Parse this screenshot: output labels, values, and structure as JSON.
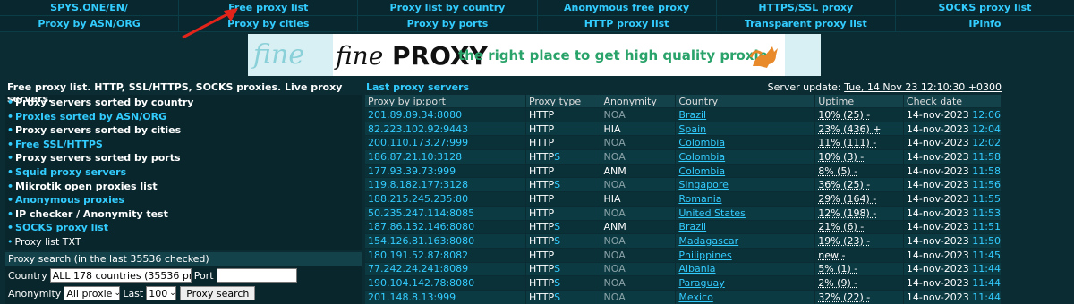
{
  "nav": {
    "row1": [
      "SPYS.ONE/EN/",
      "Free proxy list",
      "Proxy list by country",
      "Anonymous free proxy",
      "HTTPS/SSL proxy",
      "SOCKS proxy list"
    ],
    "row2": [
      "Proxy by ASN/ORG",
      "Proxy by cities",
      "Proxy by ports",
      "HTTP proxy list",
      "Transparent proxy list",
      "IPinfo"
    ]
  },
  "banner": {
    "fine_text": "fine",
    "logo_italic": "fine",
    "logo_bold": "PROXY",
    "tagline": "the right place to get high quality proxies"
  },
  "left": {
    "title": "Free proxy list. HTTP, SSL/HTTPS, SOCKS proxies. Live proxy servers.",
    "menu": [
      {
        "label": "Proxy servers sorted by country",
        "style": "white"
      },
      {
        "label": "Proxies sorted by ASN/ORG",
        "style": "cyan"
      },
      {
        "label": "Proxy servers sorted by cities",
        "style": "white"
      },
      {
        "label": "Free SSL/HTTPS",
        "style": "cyan"
      },
      {
        "label": "Proxy servers sorted by ports",
        "style": "white"
      },
      {
        "label": "Squid proxy servers",
        "style": "cyan"
      },
      {
        "label": "Mikrotik open proxies list",
        "style": "white"
      },
      {
        "label": "Anonymous proxies",
        "style": "cyan"
      },
      {
        "label": "IP checker / Anonymity test",
        "style": "white"
      },
      {
        "label": "SOCKS proxy list",
        "style": "cyan"
      },
      {
        "label": "Proxy list TXT",
        "style": "plain"
      }
    ]
  },
  "search": {
    "title": "Proxy search (in the last 35536 checked)",
    "country_label": "Country",
    "country_value": "ALL 178 countries (35536 pr",
    "port_label": "Port",
    "anonymity_label": "Anonymity",
    "anonymity_value": "All proxie",
    "last_label": "Last",
    "last_value": "100",
    "button": "Proxy search"
  },
  "table": {
    "title": "Last proxy servers",
    "update_label": "Server update:",
    "update_value": "Tue, 14 Nov 23 12:10:30 +0300",
    "headers": [
      "Proxy by ip:port",
      "Proxy type",
      "Anonymity",
      "Country",
      "Uptime",
      "Check date"
    ],
    "rows": [
      {
        "ip": "201.89.89.34:8080",
        "type": "HTTP",
        "anon": "NOA",
        "country": "Brazil",
        "uptime": "10% (25) -",
        "date": "14-nov-2023",
        "time": "12:06"
      },
      {
        "ip": "82.223.102.92:9443",
        "type": "HTTP",
        "anon": "HIA",
        "country": "Spain",
        "uptime": "23% (436) +",
        "date": "14-nov-2023",
        "time": "12:04"
      },
      {
        "ip": "200.110.173.27:999",
        "type": "HTTP",
        "anon": "NOA",
        "country": "Colombia",
        "uptime": "11% (111) -",
        "date": "14-nov-2023",
        "time": "12:02"
      },
      {
        "ip": "186.87.21.10:3128",
        "type": "HTTPS",
        "anon": "NOA",
        "country": "Colombia",
        "uptime": "10% (3) -",
        "date": "14-nov-2023",
        "time": "11:58"
      },
      {
        "ip": "177.93.39.73:999",
        "type": "HTTP",
        "anon": "ANM",
        "country": "Colombia",
        "uptime": "8% (5) -",
        "date": "14-nov-2023",
        "time": "11:58"
      },
      {
        "ip": "119.8.182.177:3128",
        "type": "HTTPS",
        "anon": "NOA",
        "country": "Singapore",
        "uptime": "36% (25) -",
        "date": "14-nov-2023",
        "time": "11:56"
      },
      {
        "ip": "188.215.245.235:80",
        "type": "HTTP",
        "anon": "HIA",
        "country": "Romania",
        "uptime": "29% (164) -",
        "date": "14-nov-2023",
        "time": "11:55"
      },
      {
        "ip": "50.235.247.114:8085",
        "type": "HTTP",
        "anon": "NOA",
        "country": "United States",
        "uptime": "12% (198) -",
        "date": "14-nov-2023",
        "time": "11:53"
      },
      {
        "ip": "187.86.132.146:8080",
        "type": "HTTPS",
        "anon": "ANM",
        "country": "Brazil",
        "uptime": "21% (6) -",
        "date": "14-nov-2023",
        "time": "11:51"
      },
      {
        "ip": "154.126.81.163:8080",
        "type": "HTTPS",
        "anon": "NOA",
        "country": "Madagascar",
        "uptime": "19% (23) -",
        "date": "14-nov-2023",
        "time": "11:50"
      },
      {
        "ip": "180.191.52.87:8082",
        "type": "HTTP",
        "anon": "NOA",
        "country": "Philippines",
        "uptime": "new -",
        "date": "14-nov-2023",
        "time": "11:45"
      },
      {
        "ip": "77.242.24.241:8089",
        "type": "HTTPS",
        "anon": "NOA",
        "country": "Albania",
        "uptime": "5% (1) -",
        "date": "14-nov-2023",
        "time": "11:44"
      },
      {
        "ip": "190.104.142.78:8080",
        "type": "HTTPS",
        "anon": "NOA",
        "country": "Paraguay",
        "uptime": "2% (9) -",
        "date": "14-nov-2023",
        "time": "11:44"
      },
      {
        "ip": "201.148.8.13:999",
        "type": "HTTPS",
        "anon": "NOA",
        "country": "Mexico",
        "uptime": "32% (22) -",
        "date": "14-nov-2023",
        "time": "11:44"
      }
    ]
  },
  "colors": {
    "background": "#0b2c33",
    "accent": "#33ccff",
    "arrow": "#e3241b"
  }
}
